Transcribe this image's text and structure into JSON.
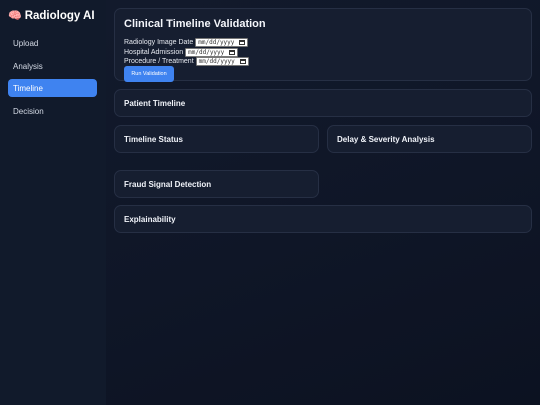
{
  "brand": {
    "icon": "brain-icon",
    "glyph": "🧠",
    "name": "Radiology AI"
  },
  "sidebar": {
    "items": [
      {
        "label": "Upload",
        "active": false
      },
      {
        "label": "Analysis",
        "active": false
      },
      {
        "label": "Timeline",
        "active": true
      },
      {
        "label": "Decision",
        "active": false
      }
    ]
  },
  "validation": {
    "title": "Clinical Timeline Validation",
    "fields": [
      {
        "label": "Radiology Image Date",
        "placeholder": "mm/dd/yyyy"
      },
      {
        "label": "Hospital Admission",
        "placeholder": "mm/dd/yyyy"
      },
      {
        "label": "Procedure / Treatment",
        "placeholder": "mm/dd/yyyy"
      }
    ],
    "run_button_label": "Run Validation"
  },
  "sections": {
    "patient_timeline": "Patient Timeline",
    "timeline_status": "Timeline Status",
    "delay_severity": "Delay & Severity Analysis",
    "fraud_signal": "Fraud Signal Detection",
    "explainability": "Explainability"
  },
  "colors": {
    "accent": "#3f83f0",
    "background": "#0d1322",
    "card": "#161e30"
  }
}
